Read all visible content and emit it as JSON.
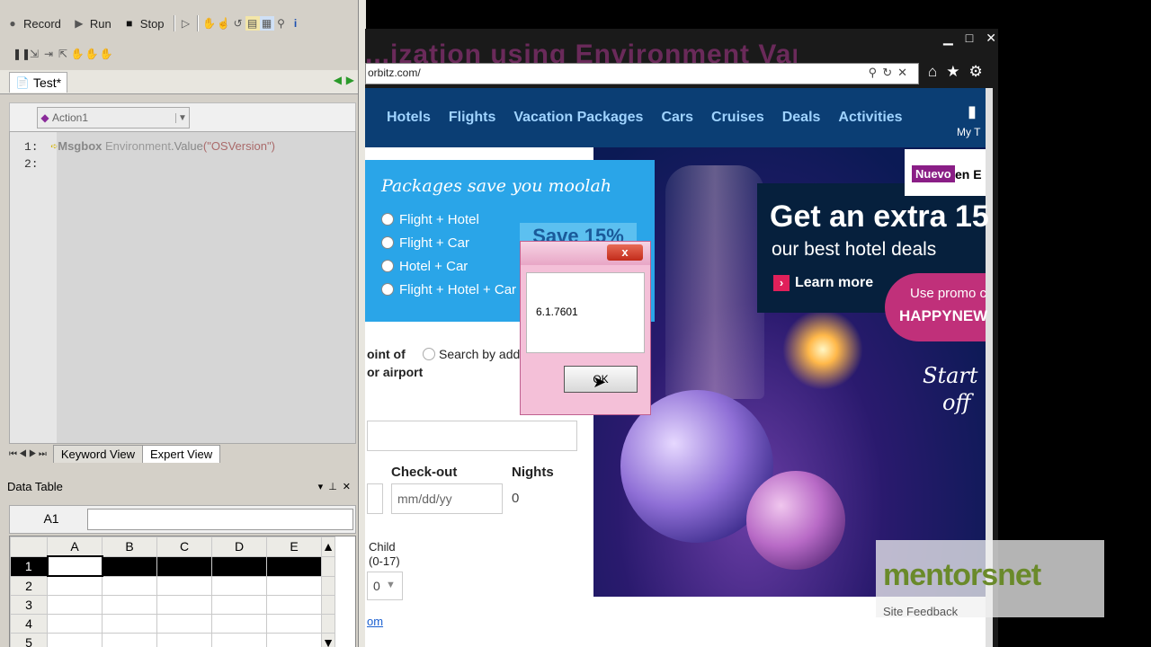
{
  "qtp": {
    "toolbar": {
      "record": "Record",
      "run": "Run",
      "stop": "Stop"
    },
    "test_tab": "Test*",
    "action_select": "Action1",
    "editor": {
      "lines": [
        {
          "num": "1:",
          "tokens": [
            "Msgbox",
            " Environment",
            ".Value",
            "(\"OSVersion\")"
          ]
        },
        {
          "num": "2:",
          "tokens": []
        }
      ]
    },
    "view_tabs": [
      "Keyword View",
      "Expert View"
    ],
    "data_table": {
      "title": "Data Table",
      "cell_ref": "A1",
      "columns": [
        "A",
        "B",
        "C",
        "D",
        "E"
      ],
      "rows": [
        "1",
        "2",
        "3",
        "4",
        "5"
      ]
    }
  },
  "browser": {
    "window_title": "...ization using Environment Variables",
    "url": "orbitz.com/",
    "nav": [
      "Hotels",
      "Flights",
      "Vacation Packages",
      "Cars",
      "Cruises",
      "Deals",
      "Activities"
    ],
    "my_trips": "My T",
    "packages": {
      "headline": "Packages save you moolah",
      "options": [
        "Flight + Hotel",
        "Flight + Car",
        "Hotel + Car",
        "Flight + Hotel + Car"
      ],
      "save_badge": "Save 15%"
    },
    "form": {
      "point_of": "oint of",
      "or_airport": "or airport",
      "search_by_address": "Search by addres",
      "checkout_label": "Check-out",
      "checkout_placeholder": "mm/dd/yy",
      "nights_label": "Nights",
      "nights_value": "0",
      "child_label": "Child",
      "child_age": "(0-17)",
      "child_value": "0",
      "link_fragment": "om"
    },
    "promo": {
      "badge_new": "Nuevo",
      "badge_lang": "en E",
      "headline": "Get an extra 15",
      "sub": "our best hotel deals",
      "learn_more": "Learn more",
      "use_promo": "Use promo c",
      "code": "HAPPYNEW",
      "start_off_1": "Start",
      "start_off_2": "off"
    },
    "site_feedback": "Site Feedback"
  },
  "dialog": {
    "message": "6.1.7601",
    "ok": "OK",
    "close": "x"
  },
  "watermark": "mentorsnet"
}
